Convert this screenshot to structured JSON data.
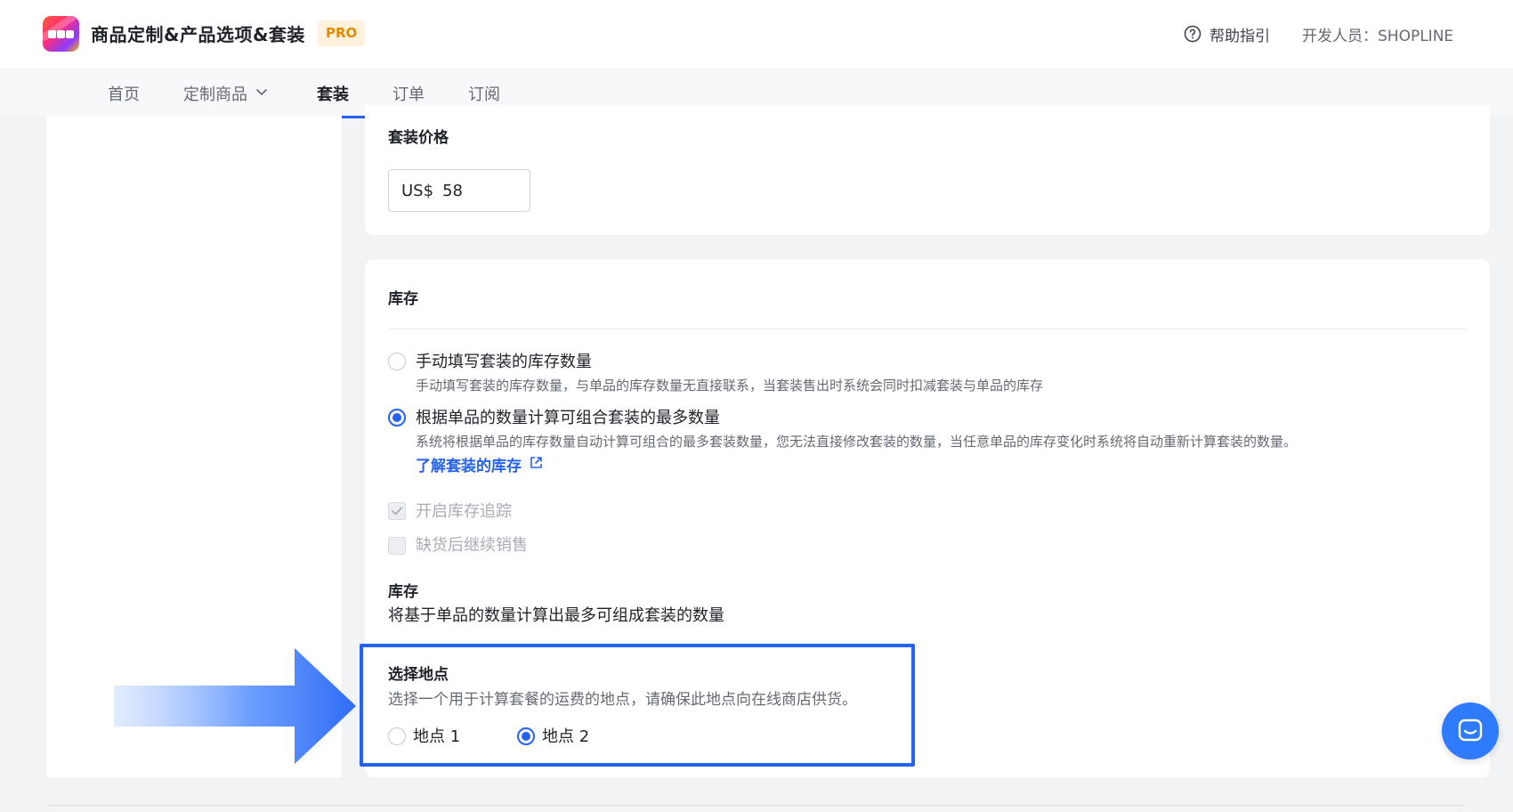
{
  "header": {
    "app_title": "商品定制&产品选项&套装",
    "badge": "PRO",
    "help_label": "帮助指引",
    "developer": "开发人员：SHOPLINE"
  },
  "nav": {
    "items": [
      {
        "label": "首页"
      },
      {
        "label": "定制商品"
      },
      {
        "label": "套装"
      },
      {
        "label": "订单"
      },
      {
        "label": "订阅"
      }
    ],
    "active": "套装"
  },
  "price_section": {
    "label": "套装价格",
    "currency": "US$",
    "value": "58"
  },
  "stock_section": {
    "title": "库存",
    "options": [
      {
        "title": "手动填写套装的库存数量",
        "description": "手动填写套装的库存数量，与单品的库存数量无直接联系，当套装售出时系统会同时扣减套装与单品的库存",
        "selected": false
      },
      {
        "title": "根据单品的数量计算可组合套装的最多数量",
        "description": "系统将根据单品的库存数量自动计算可组合的最多套装数量，您无法直接修改套装的数量，当任意单品的库存变化时系统将自动重新计算套装的数量。",
        "selected": true
      }
    ],
    "learn_link": "了解套装的库存",
    "checkboxes": [
      {
        "label": "开启库存追踪",
        "checked": true,
        "disabled": true
      },
      {
        "label": "缺货后继续销售",
        "checked": false,
        "disabled": true
      }
    ],
    "stock_label": "库存",
    "stock_note": "将基于单品的数量计算出最多可组成套装的数量"
  },
  "location_section": {
    "title": "选择地点",
    "description": "选择一个用于计算套餐的运费的地点，请确保此地点向在线商店供货。",
    "options": [
      {
        "label": "地点 1",
        "selected": false
      },
      {
        "label": "地点 2",
        "selected": true
      }
    ]
  },
  "colors": {
    "accent": "#2462f0",
    "highlight": "#2462f0",
    "pro_badge_bg": "#fff1dc",
    "pro_badge_text": "#e48a00"
  }
}
